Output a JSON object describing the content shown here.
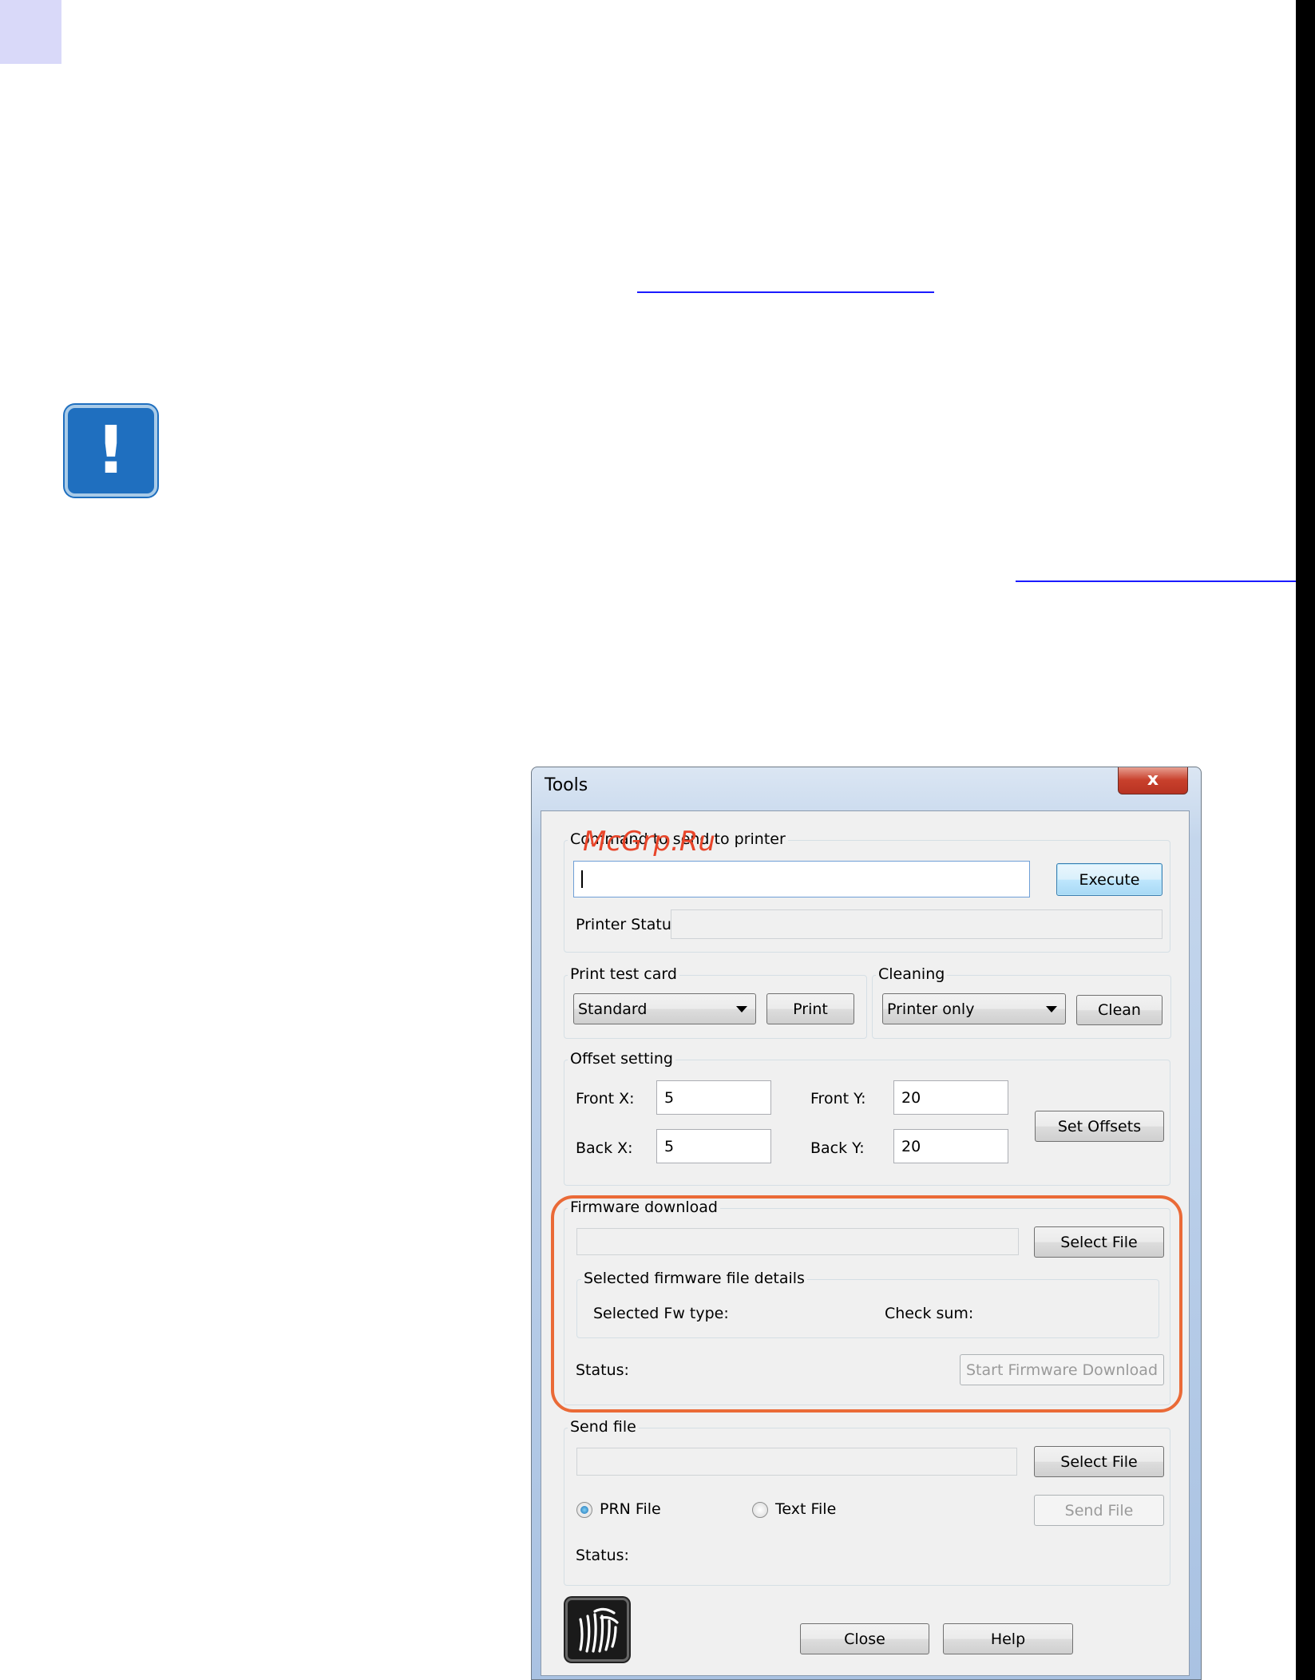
{
  "window": {
    "title": "Tools",
    "close_glyph": "x"
  },
  "watermark": "McGrp.Ru",
  "command": {
    "legend": "Command to send to printer",
    "input_value": "",
    "execute_label": "Execute",
    "printer_status_label": "Printer Status:",
    "printer_status_value": ""
  },
  "test_card": {
    "legend": "Print test card",
    "selected": "Standard",
    "print_label": "Print"
  },
  "cleaning": {
    "legend": "Cleaning",
    "selected": "Printer only",
    "clean_label": "Clean"
  },
  "offsets": {
    "legend": "Offset setting",
    "front_x_label": "Front X:",
    "front_x_value": "5",
    "front_y_label": "Front Y:",
    "front_y_value": "20",
    "back_x_label": "Back X:",
    "back_x_value": "5",
    "back_y_label": "Back Y:",
    "back_y_value": "20",
    "set_label": "Set Offsets"
  },
  "firmware": {
    "legend": "Firmware download",
    "file_value": "",
    "select_label": "Select File",
    "details_legend": "Selected firmware file details",
    "fw_type_label": "Selected Fw type:",
    "checksum_label": "Check sum:",
    "status_label": "Status:",
    "start_label": "Start Firmware Download"
  },
  "send_file": {
    "legend": "Send file",
    "file_value": "",
    "select_label": "Select File",
    "prn_label": "PRN File",
    "text_label": "Text File",
    "selected_type": "PRN File",
    "send_label": "Send File",
    "status_label": "Status:"
  },
  "footer": {
    "close_label": "Close",
    "help_label": "Help",
    "logo_icon": "zebra-logo-icon"
  },
  "colors": {
    "highlight": "#ea6a37",
    "important_icon": "#1f6fbf",
    "link_line": "#1a1aff"
  }
}
